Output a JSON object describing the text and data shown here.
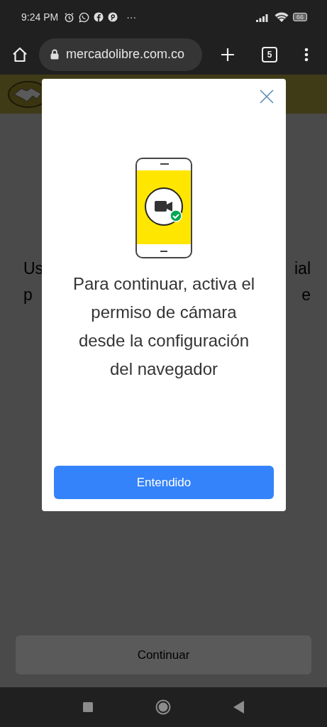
{
  "status_bar": {
    "time": "9:24 PM",
    "more": "···",
    "battery": "66"
  },
  "browser": {
    "url": "mercadolibre.com.co",
    "tab_count": "5"
  },
  "page": {
    "text_lines": [
      {
        "left": "Us",
        "right": "ial"
      },
      {
        "left": "p",
        "right": "e"
      }
    ],
    "button": "Continuar"
  },
  "dialog": {
    "message": "Para continuar, activa el permiso de cámara desde la configuración del navegador",
    "button": "Entendido"
  }
}
